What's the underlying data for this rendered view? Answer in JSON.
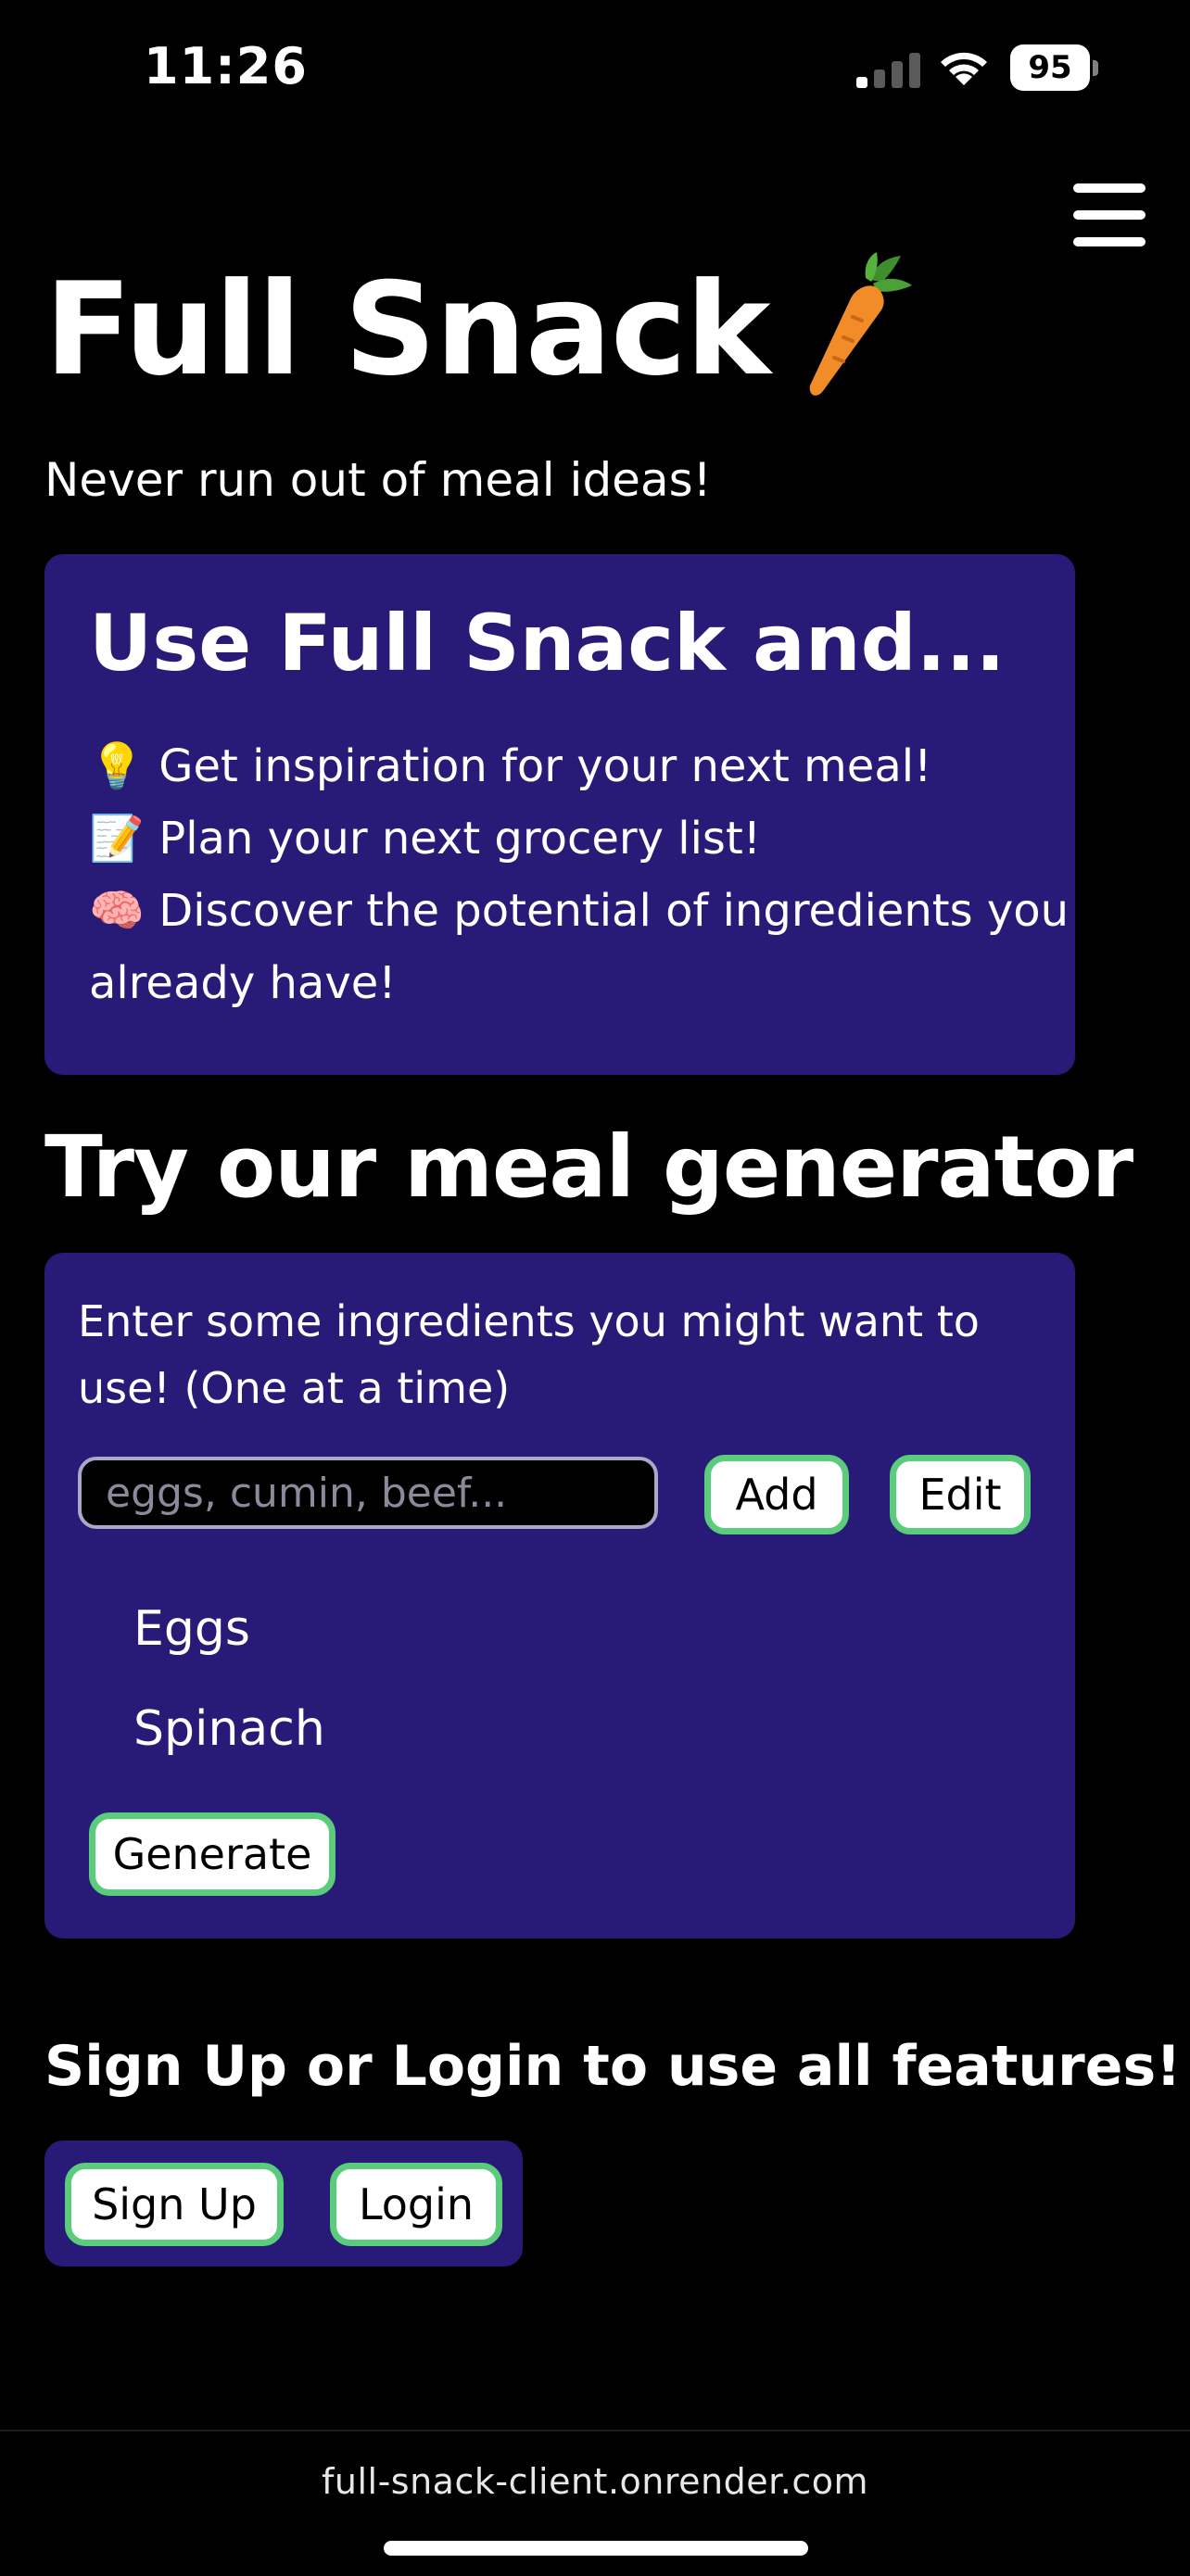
{
  "status_bar": {
    "time": "11:26",
    "battery": "95",
    "icons": [
      "signal-icon",
      "wifi-icon",
      "battery-icon"
    ]
  },
  "header": {
    "title": "Full Snack",
    "title_icon": "carrot-icon",
    "tagline": "Never run out of meal ideas!",
    "menu_icon": "hamburger-menu-icon"
  },
  "features": {
    "heading": "Use Full Snack and...",
    "items": [
      {
        "icon": "💡",
        "text": "Get inspiration for your next meal!"
      },
      {
        "icon": "📝",
        "text": "Plan your next grocery list!"
      },
      {
        "icon": "🧠",
        "text": "Discover the potential of ingredients you already have!"
      }
    ]
  },
  "generator": {
    "title": "Try our meal generator",
    "instructions": "Enter some ingredients you might want to use! (One at a time)",
    "input_placeholder": "eggs, cumin, beef...",
    "input_value": "",
    "add_label": "Add",
    "edit_label": "Edit",
    "ingredients": [
      "Eggs",
      "Spinach"
    ],
    "generate_label": "Generate"
  },
  "auth": {
    "heading": "Sign Up or Login to use all features!",
    "signup_label": "Sign Up",
    "login_label": "Login"
  },
  "browser": {
    "url": "full-snack-client.onrender.com"
  },
  "colors": {
    "background": "#000000",
    "card": "#281b78",
    "button_border": "#5bcc7c",
    "text": "#ffffff"
  }
}
